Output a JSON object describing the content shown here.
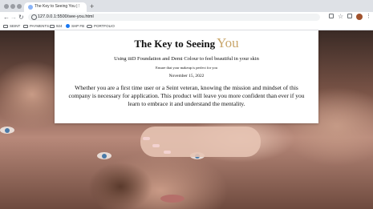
{
  "browser": {
    "tab": {
      "title": "The Key to Seeing You | Seint ×"
    },
    "address_bar": {
      "url": "127.0.0.1:5500/see-you.html"
    }
  },
  "bookmarks": [
    {
      "label": "SEINT",
      "icon": "folder-icon"
    },
    {
      "label": "PAYMENTS",
      "icon": "folder-icon"
    },
    {
      "label": "924",
      "icon": "folder-icon"
    },
    {
      "label": "SHP FB",
      "icon": "facebook-icon"
    },
    {
      "label": "PORTFOLIO",
      "icon": "link-icon"
    }
  ],
  "page": {
    "heading_main": "The Key to Seeing",
    "heading_accent": "You",
    "subtitle": "Using iiiD Foundation and Demi Colour to feel beautiful in your skin",
    "tagline": "Ensure that your makeup is perfect for you",
    "date": "November 15, 2022",
    "body": "Whether you are a first time user or a Seint veteran, knowing the mission and mindset of this company is necessary for application. This product will leave you more confident than ever if you learn to embrace it and understand the mentality."
  },
  "colors": {
    "accent_gold": "#c9a66b",
    "card_bg": "#ffffff",
    "text": "#111111"
  }
}
